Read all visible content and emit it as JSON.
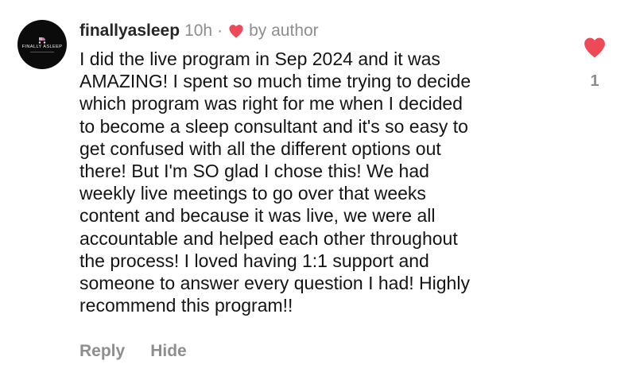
{
  "comment": {
    "avatar_text": "FINALLY ASLEEP",
    "username": "finallyasleep",
    "time_ago": "10h",
    "separator": "·",
    "liked_by_label": "by author",
    "body": "I did the live program in Sep 2024 and it was\nAMAZING! I spent so much time trying to decide\nwhich program was right for me when I decided\nto become a sleep consultant and it's so easy to\nget confused with all the different options out\nthere! But I'm SO glad I chose this! We had\nweekly live meetings to go over that weeks\ncontent and because it was live, we were all\naccountable and helped each other throughout\nthe process! I loved having 1:1 support and\nsomeone to answer every question I had! Highly\nrecommend this program!!",
    "like_count": "1",
    "liked": true,
    "actions": {
      "reply_label": "Reply",
      "hide_label": "Hide"
    }
  },
  "icons": {
    "author_like": "heart-filled-icon",
    "like_button": "heart-filled-icon",
    "avatar_logo": "pram-icon"
  },
  "colors": {
    "heart": "#ed4956",
    "muted_text": "#8e8e8e",
    "username": "#262626",
    "avatar_bg": "#0b0b0b"
  }
}
